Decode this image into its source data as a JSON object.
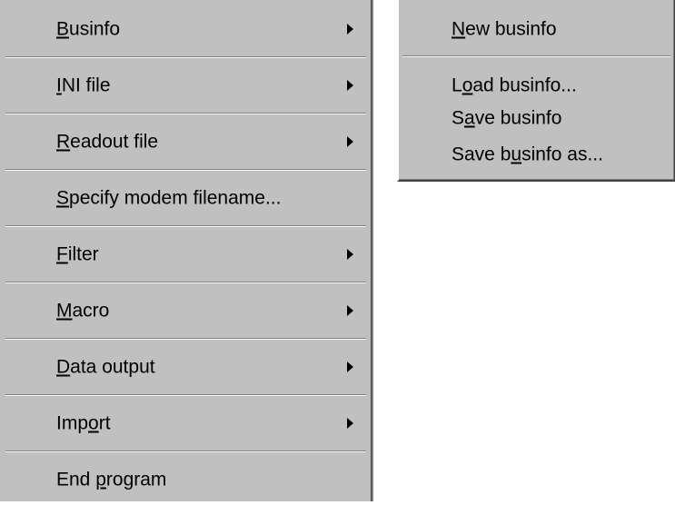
{
  "main_menu": {
    "items": [
      {
        "pre": "",
        "key": "B",
        "post": "usinfo",
        "has_submenu": true
      },
      {
        "pre": "",
        "key": "I",
        "post": "NI file",
        "has_submenu": true
      },
      {
        "pre": "",
        "key": "R",
        "post": "eadout file",
        "has_submenu": true
      },
      {
        "pre": "",
        "key": "S",
        "post": "pecify modem filename...",
        "has_submenu": false
      },
      {
        "pre": "",
        "key": "F",
        "post": "ilter",
        "has_submenu": true
      },
      {
        "pre": "",
        "key": "M",
        "post": "acro",
        "has_submenu": true
      },
      {
        "pre": "",
        "key": "D",
        "post": "ata output",
        "has_submenu": true
      },
      {
        "pre": "Imp",
        "key": "o",
        "post": "rt",
        "has_submenu": true
      },
      {
        "pre": "End ",
        "key": "p",
        "post": "rogram",
        "has_submenu": false
      }
    ]
  },
  "submenu": {
    "parent": "Businfo",
    "items": [
      {
        "pre": "",
        "key": "N",
        "post": "ew businfo"
      },
      {
        "pre": "L",
        "key": "o",
        "post": "ad businfo..."
      },
      {
        "pre": "S",
        "key": "a",
        "post": "ve businfo"
      },
      {
        "pre": "Save b",
        "key": "u",
        "post": "sinfo as..."
      }
    ]
  }
}
